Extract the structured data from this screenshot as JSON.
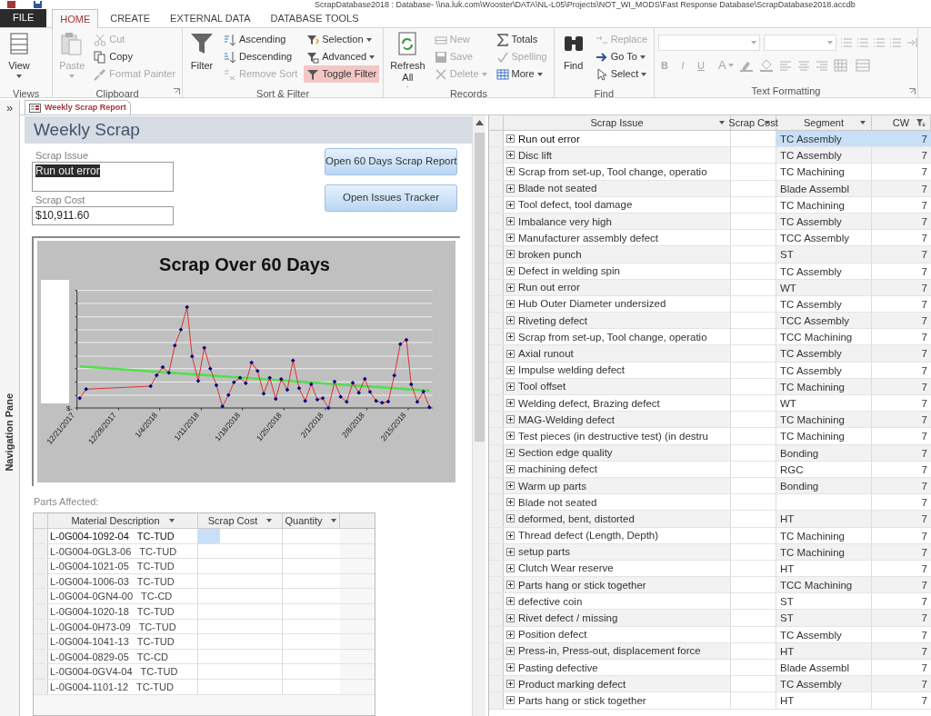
{
  "window": {
    "title": "ScrapDatabase2018 : Database- \\\\na.luk.com\\Wooster\\DATA\\NL-L05\\Projects\\NOT_WI_MODS\\Fast Response Database\\ScrapDatabase2018.accdb"
  },
  "ribbon_tabs": [
    {
      "label": "FILE",
      "kind": "file",
      "selected": false
    },
    {
      "label": "HOME",
      "kind": "tab",
      "selected": true
    },
    {
      "label": "CREATE",
      "kind": "tab",
      "selected": false
    },
    {
      "label": "EXTERNAL DATA",
      "kind": "tab",
      "selected": false
    },
    {
      "label": "DATABASE TOOLS",
      "kind": "tab",
      "selected": false
    }
  ],
  "ribbon": {
    "groups": [
      {
        "label": "Views",
        "kind": "commands",
        "launcher": false,
        "columns": [
          [
            {
              "label": "View",
              "kind": "large-menu",
              "disabled": false,
              "selected": false
            }
          ]
        ]
      },
      {
        "label": "Clipboard",
        "kind": "commands",
        "launcher": true,
        "columns": [
          [
            {
              "label": "Paste",
              "kind": "large-menu",
              "disabled": true,
              "selected": false
            }
          ],
          [
            {
              "label": "Cut",
              "kind": "small",
              "disabled": true,
              "selected": false
            },
            {
              "label": "Copy",
              "kind": "small",
              "disabled": false,
              "selected": false
            },
            {
              "label": "Format Painter",
              "kind": "small",
              "disabled": true,
              "selected": false
            }
          ]
        ]
      },
      {
        "label": "Sort & Filter",
        "kind": "commands",
        "launcher": false,
        "columns": [
          [
            {
              "label": "Filter",
              "kind": "large",
              "disabled": false,
              "selected": false
            }
          ],
          [
            {
              "label": "Ascending",
              "kind": "small",
              "disabled": false,
              "selected": false
            },
            {
              "label": "Descending",
              "kind": "small",
              "disabled": false,
              "selected": false
            },
            {
              "label": "Remove Sort",
              "kind": "small",
              "disabled": true,
              "selected": false
            }
          ],
          [
            {
              "label": "Selection",
              "kind": "small-menu",
              "disabled": false,
              "selected": false
            },
            {
              "label": "Advanced",
              "kind": "small-menu",
              "disabled": false,
              "selected": false
            },
            {
              "label": "Toggle Filter",
              "kind": "small",
              "disabled": false,
              "selected": true
            }
          ]
        ]
      },
      {
        "label": "Records",
        "kind": "commands",
        "launcher": false,
        "columns": [
          [
            {
              "label": "Refresh All",
              "kind": "large-menu",
              "disabled": false,
              "selected": false
            }
          ],
          [
            {
              "label": "New",
              "kind": "small",
              "disabled": true,
              "selected": false
            },
            {
              "label": "Save",
              "kind": "small",
              "disabled": true,
              "selected": false
            },
            {
              "label": "Delete",
              "kind": "small-menu",
              "disabled": true,
              "selected": false
            }
          ],
          [
            {
              "label": "Totals",
              "kind": "small",
              "disabled": false,
              "selected": false
            },
            {
              "label": "Spelling",
              "kind": "small",
              "disabled": true,
              "selected": false
            },
            {
              "label": "More",
              "kind": "small-menu",
              "disabled": false,
              "selected": false
            }
          ]
        ]
      },
      {
        "label": "Find",
        "kind": "commands",
        "launcher": false,
        "columns": [
          [
            {
              "label": "Find",
              "kind": "large",
              "disabled": false,
              "selected": false
            }
          ],
          [
            {
              "label": "Replace",
              "kind": "small",
              "disabled": true,
              "selected": false
            },
            {
              "label": "Go To",
              "kind": "small-menu",
              "disabled": false,
              "selected": false
            },
            {
              "label": "Select",
              "kind": "small-menu",
              "disabled": false,
              "selected": false
            }
          ]
        ]
      },
      {
        "label": "Text Formatting",
        "kind": "formatting",
        "launcher": true,
        "disabled": true,
        "style_buttons": [
          "B",
          "I",
          "U"
        ],
        "color_button": "A"
      }
    ]
  },
  "navigation_pane": {
    "toggle": "»",
    "label": "Navigation Pane"
  },
  "document_tabs": [
    {
      "label": "Weekly Scrap Report",
      "selected": true
    }
  ],
  "form": {
    "title": "Weekly Scrap",
    "fields": [
      {
        "label": "Scrap Issue",
        "value": "Run out error",
        "kind": "memo",
        "value_selected": true
      },
      {
        "label": "Scrap Cost",
        "value": "$10,911.60",
        "kind": "text",
        "value_selected": false
      }
    ],
    "buttons": [
      "Open 60 Days Scrap Report",
      "Open Issues Tracker"
    ],
    "chart": {
      "title": "Scrap Over 60 Days",
      "y_zero_label": "$-",
      "x_labels": [
        "12/21/2017",
        "12/28/2017",
        "1/4/2018",
        "1/11/2018",
        "1/18/2018",
        "1/25/2018",
        "2/1/2018",
        "2/8/2018",
        "2/15/2018"
      ]
    },
    "parts": {
      "label": "Parts Affected:",
      "columns": [
        "Material Description",
        "Scrap Cost",
        "Quantity"
      ],
      "rows": [
        {
          "material": "L-0G004-1092-04   TC-TUD",
          "selected": true
        },
        {
          "material": "L-0G004-0GL3-06   TC-TUD",
          "selected": false
        },
        {
          "material": "L-0G004-1021-05   TC-TUD",
          "selected": false
        },
        {
          "material": "L-0G004-1006-03   TC-TUD",
          "selected": false
        },
        {
          "material": "L-0G004-0GN4-00   TC-CD",
          "selected": false
        },
        {
          "material": "L-0G004-1020-18   TC-TUD",
          "selected": false
        },
        {
          "material": "L-0G004-0H73-09   TC-TUD",
          "selected": false
        },
        {
          "material": "L-0G004-1041-13   TC-TUD",
          "selected": false
        },
        {
          "material": "L-0G004-0829-05   TC-CD",
          "selected": false
        },
        {
          "material": "L-0G004-0GV4-04   TC-TUD",
          "selected": false
        },
        {
          "material": "L-0G004-1101-12   TC-TUD",
          "selected": false
        }
      ]
    }
  },
  "datasheet": {
    "columns": [
      {
        "label": "Scrap Issue",
        "filtered": false
      },
      {
        "label": "Scrap Cost",
        "filtered": false
      },
      {
        "label": "Segment",
        "filtered": false
      },
      {
        "label": "CW",
        "filtered": true
      }
    ],
    "rows": [
      {
        "issue": "Run out error",
        "segment": "TC Assembly",
        "cw": "7",
        "selected": true
      },
      {
        "issue": "Disc lift",
        "segment": "TC Assembly",
        "cw": "7",
        "selected": false
      },
      {
        "issue": "Scrap from set-up, Tool change, operatio",
        "segment": "TC Machining",
        "cw": "7",
        "selected": false
      },
      {
        "issue": "Blade not seated",
        "segment": "Blade Assembl",
        "cw": "7",
        "selected": false
      },
      {
        "issue": "Tool defect, tool damage",
        "segment": "TC Machining",
        "cw": "7",
        "selected": false
      },
      {
        "issue": "Imbalance very high",
        "segment": "TC Assembly",
        "cw": "7",
        "selected": false
      },
      {
        "issue": "Manufacturer assembly defect",
        "segment": "TCC Assembly",
        "cw": "7",
        "selected": false
      },
      {
        "issue": "broken punch",
        "segment": "ST",
        "cw": "7",
        "selected": false
      },
      {
        "issue": "Defect in welding spin",
        "segment": "TC Assembly",
        "cw": "7",
        "selected": false
      },
      {
        "issue": "Run out error",
        "segment": "WT",
        "cw": "7",
        "selected": false
      },
      {
        "issue": "Hub Outer Diameter undersized",
        "segment": "TC Assembly",
        "cw": "7",
        "selected": false
      },
      {
        "issue": "Riveting defect",
        "segment": "TCC Assembly",
        "cw": "7",
        "selected": false
      },
      {
        "issue": "Scrap from set-up, Tool change, operatio",
        "segment": "TCC Machining",
        "cw": "7",
        "selected": false
      },
      {
        "issue": "Axial runout",
        "segment": "TC Assembly",
        "cw": "7",
        "selected": false
      },
      {
        "issue": "Impulse welding defect",
        "segment": "TC Assembly",
        "cw": "7",
        "selected": false
      },
      {
        "issue": "Tool offset",
        "segment": "TC Machining",
        "cw": "7",
        "selected": false
      },
      {
        "issue": "Welding defect, Brazing defect",
        "segment": "WT",
        "cw": "7",
        "selected": false
      },
      {
        "issue": "MAG-Welding defect",
        "segment": "TC Machining",
        "cw": "7",
        "selected": false
      },
      {
        "issue": "Test pieces (in destructive test) (in destru",
        "segment": "TC Machining",
        "cw": "7",
        "selected": false
      },
      {
        "issue": "Section edge quality",
        "segment": "Bonding",
        "cw": "7",
        "selected": false
      },
      {
        "issue": "machining defect",
        "segment": "RGC",
        "cw": "7",
        "selected": false
      },
      {
        "issue": "Warm up parts",
        "segment": "Bonding",
        "cw": "7",
        "selected": false
      },
      {
        "issue": "Blade not seated",
        "cw": "7",
        "selected": false
      },
      {
        "issue": "deformed, bent, distorted",
        "segment": "HT",
        "cw": "7",
        "selected": false
      },
      {
        "issue": "Thread defect (Length, Depth)",
        "segment": "TC Machining",
        "cw": "7",
        "selected": false
      },
      {
        "issue": "setup parts",
        "segment": "TC Machining",
        "cw": "7",
        "selected": false
      },
      {
        "issue": "Clutch Wear reserve",
        "segment": "HT",
        "cw": "7",
        "selected": false
      },
      {
        "issue": "Parts hang or stick together",
        "segment": "TCC Machining",
        "cw": "7",
        "selected": false
      },
      {
        "issue": "defective coin",
        "segment": "ST",
        "cw": "7",
        "selected": false
      },
      {
        "issue": "Rivet defect / missing",
        "segment": "ST",
        "cw": "7",
        "selected": false
      },
      {
        "issue": "Position defect",
        "segment": "TC Assembly",
        "cw": "7",
        "selected": false
      },
      {
        "issue": "Press-in, Press-out, displacement force",
        "segment": "HT",
        "cw": "7",
        "selected": false
      },
      {
        "issue": "Pasting defective",
        "segment": "Blade Assembl",
        "cw": "7",
        "selected": false
      },
      {
        "issue": "Product marking defect",
        "segment": "TC Assembly",
        "cw": "7",
        "selected": false
      },
      {
        "issue": "Parts hang or stick together",
        "segment": "HT",
        "cw": "7",
        "selected": false
      }
    ]
  }
}
